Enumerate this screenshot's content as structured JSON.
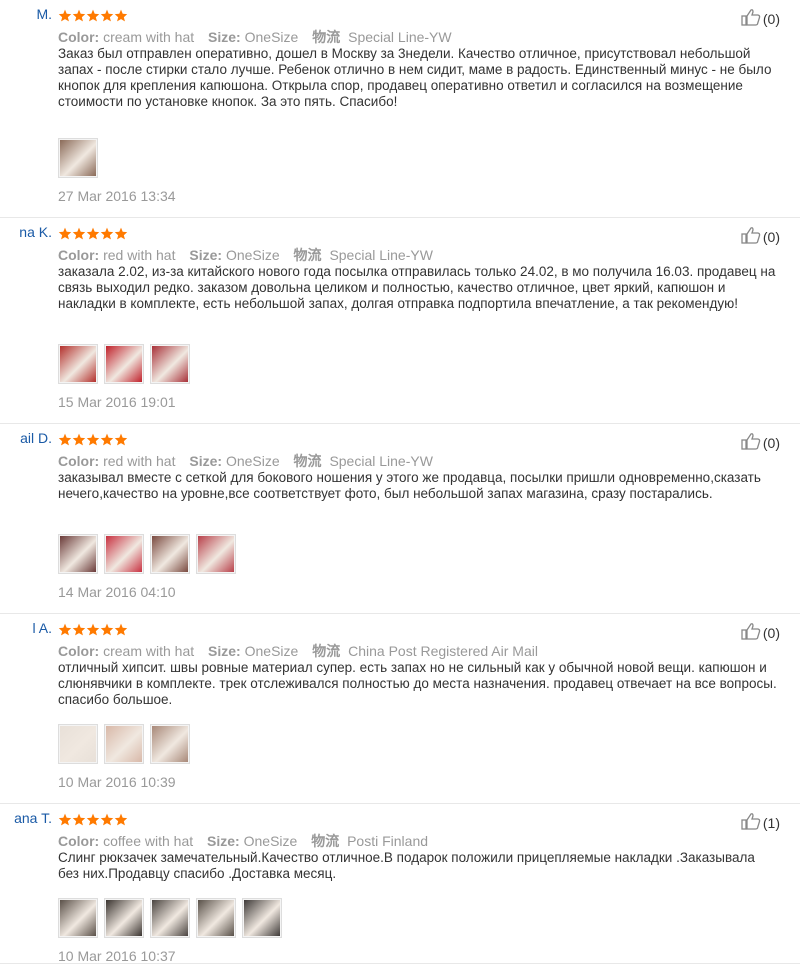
{
  "reviews": [
    {
      "user": "M.",
      "rating": 5,
      "color_label": "Color:",
      "color_value": "cream with hat",
      "size_label": "Size:",
      "size_value": "OneSize",
      "ship_label": "物流",
      "ship_value": "Special Line-YW",
      "text": "Заказ был отправлен оперативно, дошел в Москву за 3недели. Качество отличное, присутствовал небольшой запах - после стирки стало лучше. Ребенок отлично в нем сидит, маме в радость. Единственный минус - не было кнопок для крепления капюшона. Открыла спор, продавец оперативно ответил и согласился на возмещение стоимости по установке кнопок. За это пять. Спасибо!",
      "photos": [
        "#8a6a58"
      ],
      "date": "27 Mar 2016 13:34",
      "helpful": "(0)"
    },
    {
      "user": "na K.",
      "rating": 5,
      "color_label": "Color:",
      "color_value": "red with hat",
      "size_label": "Size:",
      "size_value": "OneSize",
      "ship_label": "物流",
      "ship_value": "Special Line-YW",
      "text": "заказала 2.02, из-за китайского нового года посылка отправилась только 24.02, в мо получила 16.03. продавец на связь выходил редко. заказом довольна целиком и полностью, качество отличное, цвет яркий, капюшон и накладки в комплекте, есть небольшой запах, долгая отправка подпортила впечатление, а так рекомендую!",
      "photos": [
        "#b3302c",
        "#c0202a",
        "#a83038"
      ],
      "date": "15 Mar 2016 19:01",
      "helpful": "(0)"
    },
    {
      "user": "ail D.",
      "rating": 5,
      "color_label": "Color:",
      "color_value": "red with hat",
      "size_label": "Size:",
      "size_value": "OneSize",
      "ship_label": "物流",
      "ship_value": "Special Line-YW",
      "text": "заказывал вместе с сеткой для бокового ношения у этого же продавца, посылки пришли одновременно,сказать нечего,качество на уровне,все соответствует фото, был небольшой запах магазина, сразу постарались.",
      "photos": [
        "#6a3a38",
        "#c83040",
        "#7a4a40",
        "#b8404a"
      ],
      "date": "14 Mar 2016 04:10",
      "helpful": "(0)"
    },
    {
      "user": "l A.",
      "rating": 5,
      "color_label": "Color:",
      "color_value": "cream with hat",
      "size_label": "Size:",
      "size_value": "OneSize",
      "ship_label": "物流",
      "ship_value": "China Post Registered Air Mail",
      "text": "отличный хипсит. швы ровные материал супер. есть запах но не сильный как у обычной новой вещи. капюшон и слюнявчики в комплекте. трек отслеживался полностью до места назначения. продавец отвечает на все вопросы. спасибо большое.",
      "photos": [
        "#e8e0d8",
        "#d8b8a8",
        "#a88878"
      ],
      "date": "10 Mar 2016 10:39",
      "helpful": "(0)"
    },
    {
      "user": "ana T.",
      "rating": 5,
      "color_label": "Color:",
      "color_value": "coffee with hat",
      "size_label": "Size:",
      "size_value": "OneSize",
      "ship_label": "物流",
      "ship_value": "Posti Finland",
      "text": "Слинг рюкзачек замечательный.Качество отличное.В подарок положили прицепляемые накладки .Заказывала без них.Продавцу спасибо .Доставка месяц.",
      "photos": [
        "#5a5048",
        "#3a3430",
        "#4a4440",
        "#585048",
        "#3e3a38"
      ],
      "date": "10 Mar 2016 10:37",
      "helpful": "(1)"
    }
  ]
}
